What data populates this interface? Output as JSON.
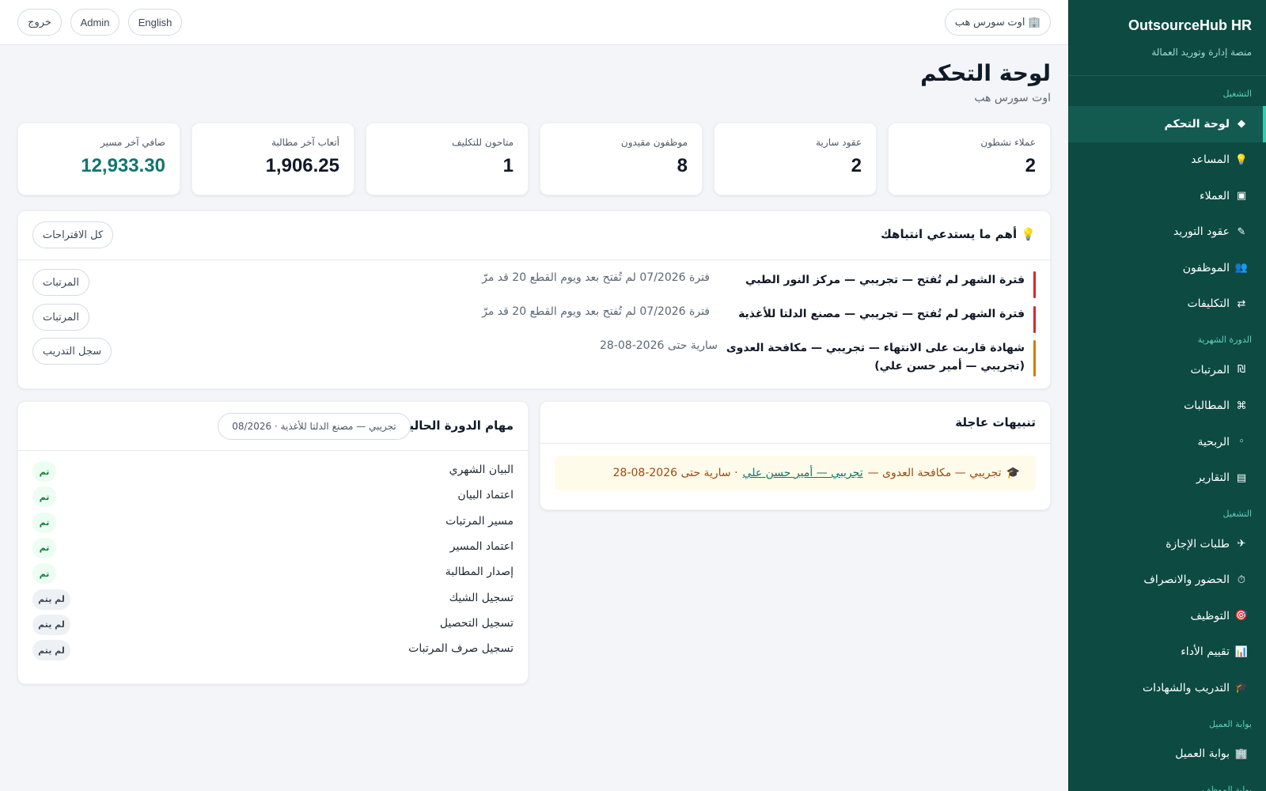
{
  "topbar": {
    "company_pill": "🏢 اوت سورس هب",
    "language_button": "English",
    "user_button": "Admin",
    "logout_button": "خروج"
  },
  "sidebar": {
    "brand_title": "OutsourceHub HR",
    "brand_subtitle": "منصة إدارة وتوريد العمالة",
    "sections": [
      {
        "label": "التشغيل",
        "items": [
          {
            "icon": "◆",
            "label": "لوحة التحكم",
            "active": true
          },
          {
            "icon": "💡",
            "label": "المساعد"
          },
          {
            "icon": "▣",
            "label": "العملاء"
          },
          {
            "icon": "✎",
            "label": "عقود التوريد"
          },
          {
            "icon": "👥",
            "label": "الموظفون"
          },
          {
            "icon": "⇄",
            "label": "التكليفات"
          }
        ]
      },
      {
        "label": "الدورة الشهرية",
        "items": [
          {
            "icon": "₪",
            "label": "المرتبات"
          },
          {
            "icon": "⌘",
            "label": "المطالبات"
          },
          {
            "icon": "◦",
            "label": "الربحية"
          },
          {
            "icon": "▤",
            "label": "التقارير"
          }
        ]
      },
      {
        "label": "التشغيل",
        "items": [
          {
            "icon": "✈",
            "label": "طلبات الإجازة"
          },
          {
            "icon": "⏱",
            "label": "الحضور والانصراف"
          },
          {
            "icon": "🎯",
            "label": "التوظيف"
          },
          {
            "icon": "📊",
            "label": "تقييم الأداء"
          },
          {
            "icon": "🎓",
            "label": "التدريب والشهادات"
          }
        ]
      },
      {
        "label": "بوابة العميل",
        "items": [
          {
            "icon": "🏢",
            "label": "بوابة العميل"
          }
        ]
      },
      {
        "label": "بوابة الموظف",
        "items": []
      }
    ]
  },
  "page": {
    "title": "لوحة التحكم",
    "subtitle": "اوت سورس هب"
  },
  "stats": [
    {
      "label": "عملاء نشطون",
      "value": "2"
    },
    {
      "label": "عقود سارية",
      "value": "2"
    },
    {
      "label": "موظفون مقيدون",
      "value": "8"
    },
    {
      "label": "متاحون للتكليف",
      "value": "1"
    },
    {
      "label": "أتعاب آخر مطالبة",
      "value": "1,906.25"
    },
    {
      "label": "صافي آخر مسير",
      "value": "12,933.30"
    }
  ],
  "attention": {
    "title": "💡 أهم ما يستدعي انتباهك",
    "all_button": "كل الاقتراحات",
    "items": [
      {
        "title": "فترة الشهر لم تُفتح — تجريبي — مركز النور الطبي",
        "desc": "فترة 07/2026 لم تُفتح بعد ويوم القطع 20 قد مرّ",
        "action": "المرتبات",
        "color": "#dc2626"
      },
      {
        "title": "فترة الشهر لم تُفتح — تجريبي — مصنع الدلتا للأغذية",
        "desc": "فترة 07/2026 لم تُفتح بعد ويوم القطع 20 قد مرّ",
        "action": "المرتبات",
        "color": "#dc2626"
      },
      {
        "title": "شهادة قاربت على الانتهاء — تجريبي — مكافحة العدوى (تجريبي — أمير حسن علي)",
        "desc": "سارية حتى 2026-08-28",
        "action": "سجل التدريب",
        "color": "#d97706"
      }
    ]
  },
  "alerts": {
    "title": "تنبيهات عاجلة",
    "item": {
      "icon": "🎓",
      "prefix": "تجريبي — مكافحة العدوى —",
      "link": "تجريبي — أمير حسن علي",
      "suffix": "· سارية حتى 2026-08-28"
    }
  },
  "tasks": {
    "title": "مهام الدورة الحالية",
    "period_pill": "تجريبي — مصنع الدلتا للأغذية · 08/2026",
    "items": [
      {
        "label": "البيان الشهري",
        "status": "تم",
        "done": true
      },
      {
        "label": "اعتماد البيان",
        "status": "تم",
        "done": true
      },
      {
        "label": "مسير المرتبات",
        "status": "تم",
        "done": true
      },
      {
        "label": "اعتماد المسير",
        "status": "تم",
        "done": true
      },
      {
        "label": "إصدار المطالبة",
        "status": "تم",
        "done": true
      },
      {
        "label": "تسجيل الشيك",
        "status": "لم يتم",
        "done": false
      },
      {
        "label": "تسجيل التحصيل",
        "status": "لم يتم",
        "done": false
      },
      {
        "label": "تسجيل صرف المرتبات",
        "status": "لم يتم",
        "done": false
      }
    ]
  },
  "colors": {
    "sidebar_bg": "#0c4a42",
    "accent": "#0f766e",
    "danger": "#dc2626",
    "warning": "#d97706"
  }
}
